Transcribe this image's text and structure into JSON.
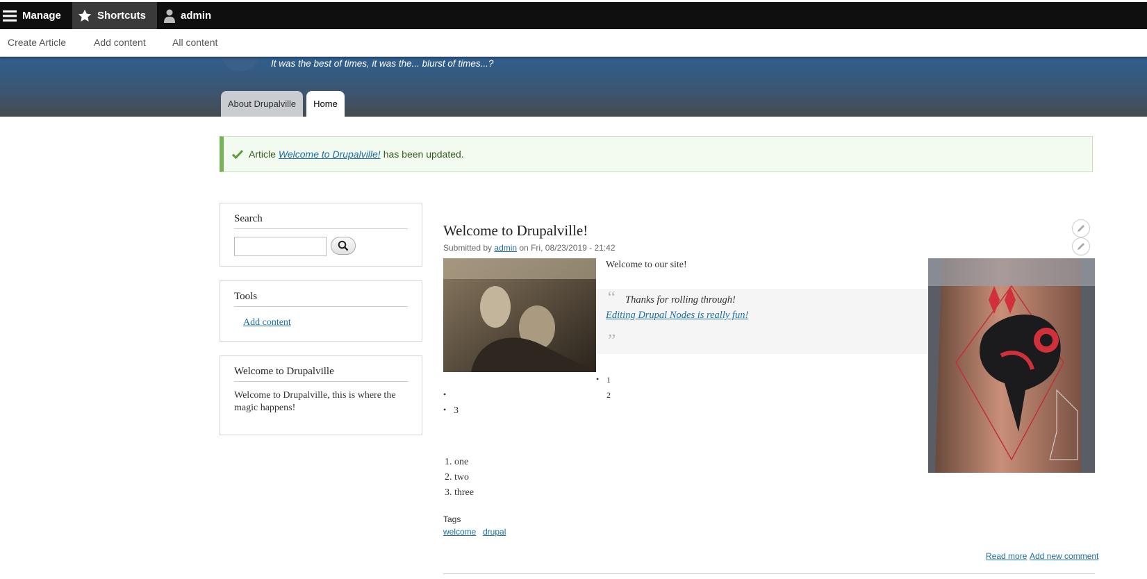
{
  "toolbar": {
    "manage": "Manage",
    "shortcuts": "Shortcuts",
    "user": "admin"
  },
  "tray": {
    "items": [
      "Create Article",
      "Add content",
      "All content"
    ]
  },
  "header": {
    "slogan": "It was the best of times, it was the... blurst of times...?",
    "tabs": [
      "About Drupalville",
      "Home"
    ],
    "active_tab": "Home"
  },
  "status_message": {
    "prefix": "Article",
    "link": "Welcome to Drupalville!",
    "suffix": "has been updated."
  },
  "sidebar": {
    "search": {
      "title": "Search",
      "value": ""
    },
    "tools": {
      "title": "Tools",
      "link": "Add content"
    },
    "welcome": {
      "title": "Welcome to Drupalville",
      "text": "Welcome to Drupalville, this is where the magic happens!"
    }
  },
  "article": {
    "title": "Welcome to Drupalville!",
    "submitted_prefix": "Submitted by",
    "author": "admin",
    "submitted_suffix": "on Fri, 08/23/2019 - 21:42",
    "intro": "Welcome to our site!",
    "quote_line1": "Thanks for rolling through!",
    "quote_line2": "Editing Drupal Nodes is really fun!",
    "quote_open": "“",
    "quote_close": "”",
    "nested_list": [
      "1",
      "2"
    ],
    "bullet_list": [
      "",
      "3"
    ],
    "ordered_list": [
      "one",
      "two",
      "three"
    ],
    "tags_label": "Tags",
    "tags": [
      "welcome",
      "drupal"
    ],
    "read_more": "Read more",
    "add_comment": "Add new comment"
  },
  "icons": {
    "manage": "hamburger-icon",
    "shortcuts": "star-icon",
    "user": "user-icon",
    "message": "checkmark-icon",
    "search": "magnifier-icon",
    "edit": "pencil-icon"
  },
  "colors": {
    "toolbar_bg": "#0f0f0f",
    "header_top": "#2f5f8f",
    "link": "#1c6ea4",
    "message_border": "#77b259"
  }
}
